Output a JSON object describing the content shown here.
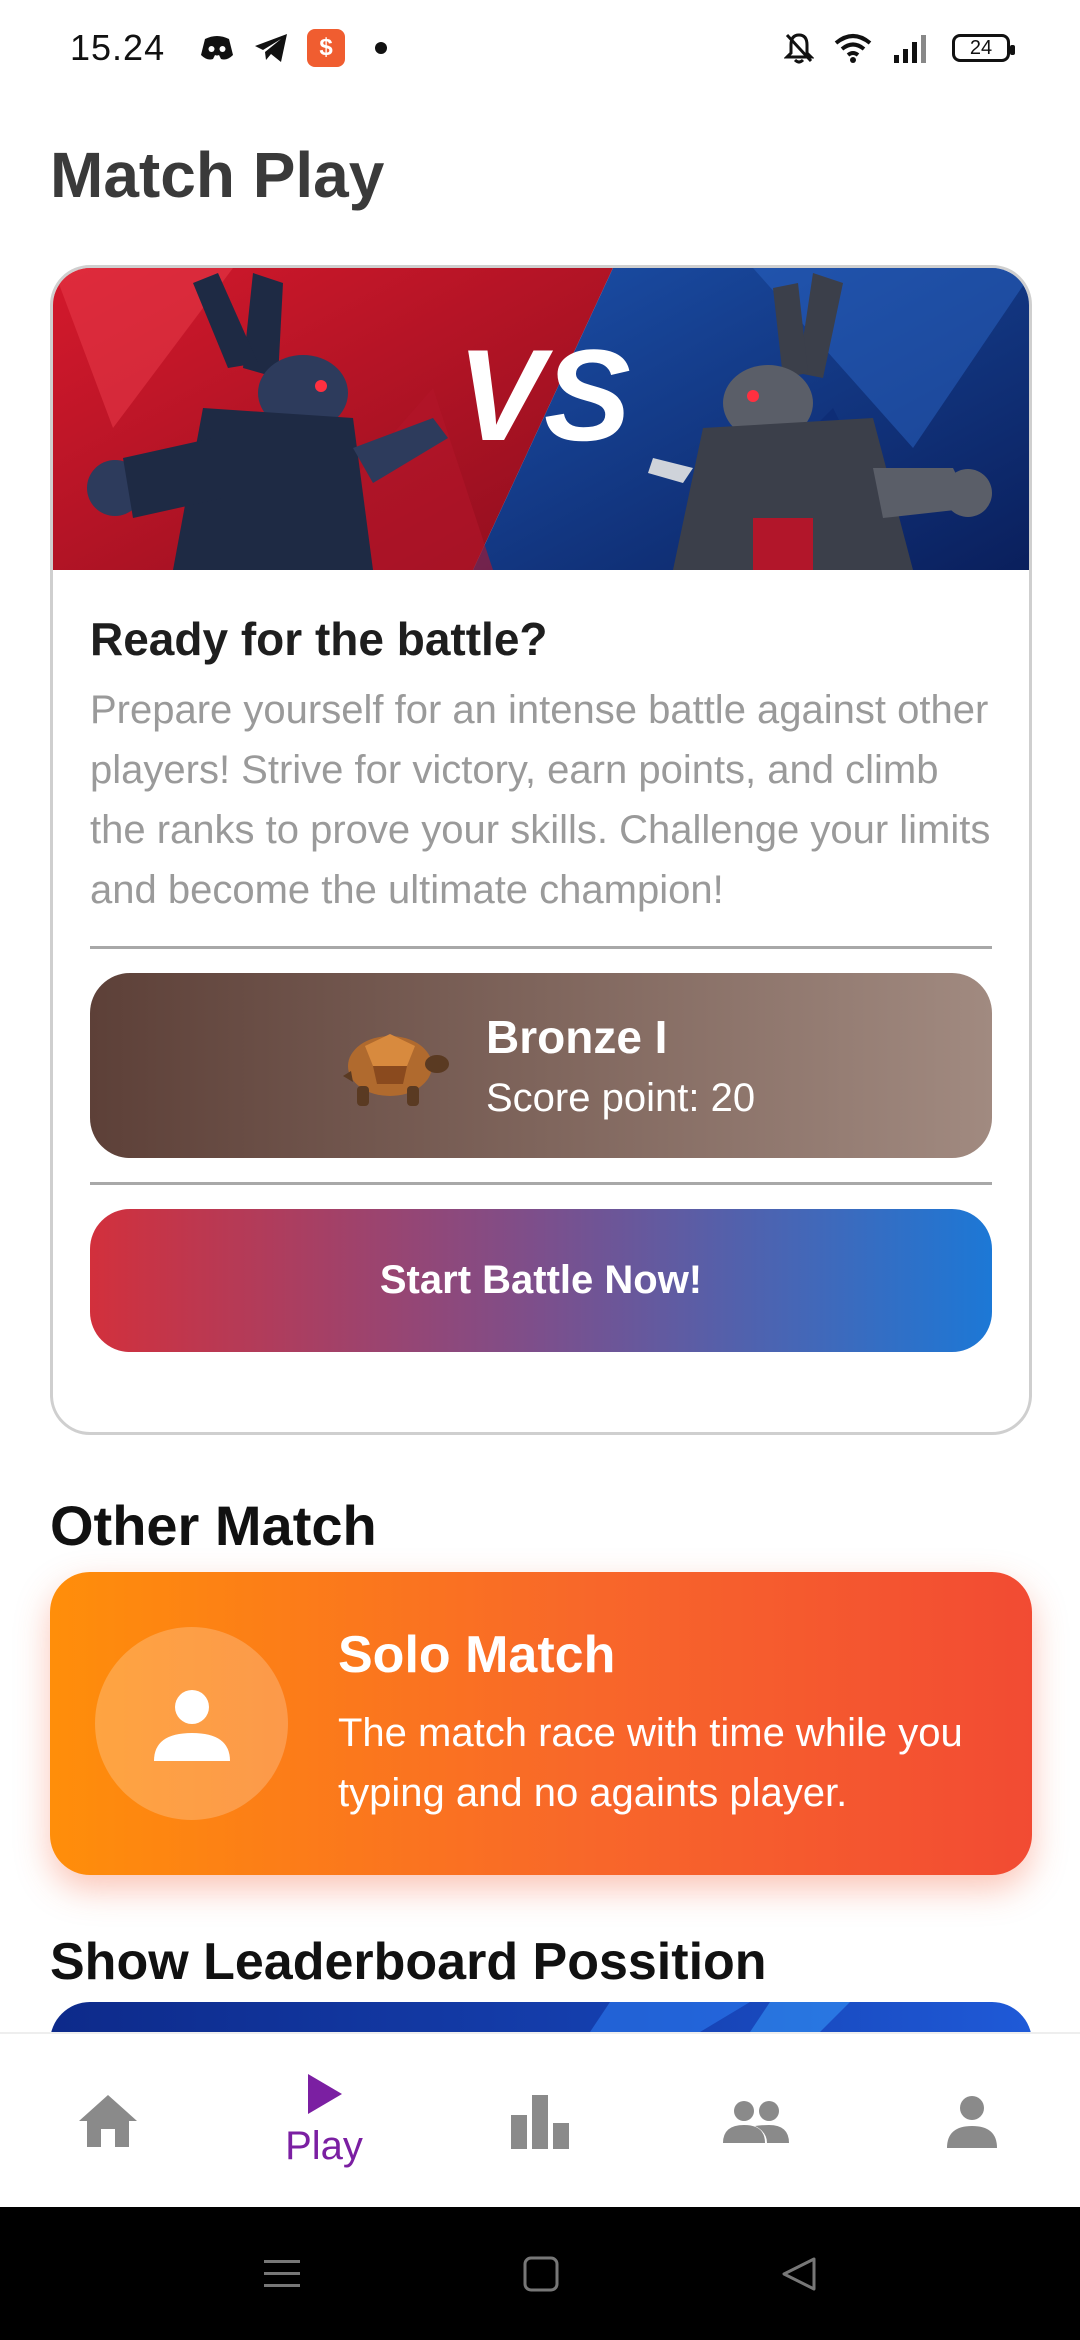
{
  "status_bar": {
    "time": "15.24",
    "battery": "24",
    "icons": [
      "discord-icon",
      "telegram-icon",
      "shop-icon",
      "notification-dot",
      "bell-off-icon",
      "wifi-icon",
      "signal-icon",
      "battery-icon"
    ]
  },
  "page": {
    "title": "Match Play"
  },
  "match_card": {
    "vs_text": "VS",
    "heading": "Ready for the battle?",
    "description": "Prepare yourself for an intense battle against other players! Strive for victory, earn points, and climb the ranks to prove your skills. Challenge your limits and become the ultimate champion!",
    "rank": {
      "name": "Bronze I",
      "score_label": "Score point: 20",
      "icon": "turtle-icon"
    },
    "start_button": "Start Battle Now!"
  },
  "other_match": {
    "title": "Other Match",
    "solo": {
      "title": "Solo Match",
      "description": "The match race with time while you typing and no againts player.",
      "icon": "person-icon"
    }
  },
  "leaderboard": {
    "title": "Show Leaderboard Possition"
  },
  "bottom_nav": {
    "items": [
      {
        "icon": "home-icon",
        "label": ""
      },
      {
        "icon": "play-icon",
        "label": "Play",
        "active": true
      },
      {
        "icon": "bar-chart-icon",
        "label": ""
      },
      {
        "icon": "group-icon",
        "label": ""
      },
      {
        "icon": "profile-icon",
        "label": ""
      }
    ]
  },
  "colors": {
    "accent_purple": "#7b1fa2",
    "inactive_icon": "#8a8a8a",
    "rank_gradient_start": "#5d4038",
    "rank_gradient_end": "#a18a80",
    "battle_gradient_start": "#d2303c",
    "battle_gradient_end": "#1c78d6",
    "solo_gradient_start": "#ff8e0a",
    "solo_gradient_end": "#f24b33"
  }
}
